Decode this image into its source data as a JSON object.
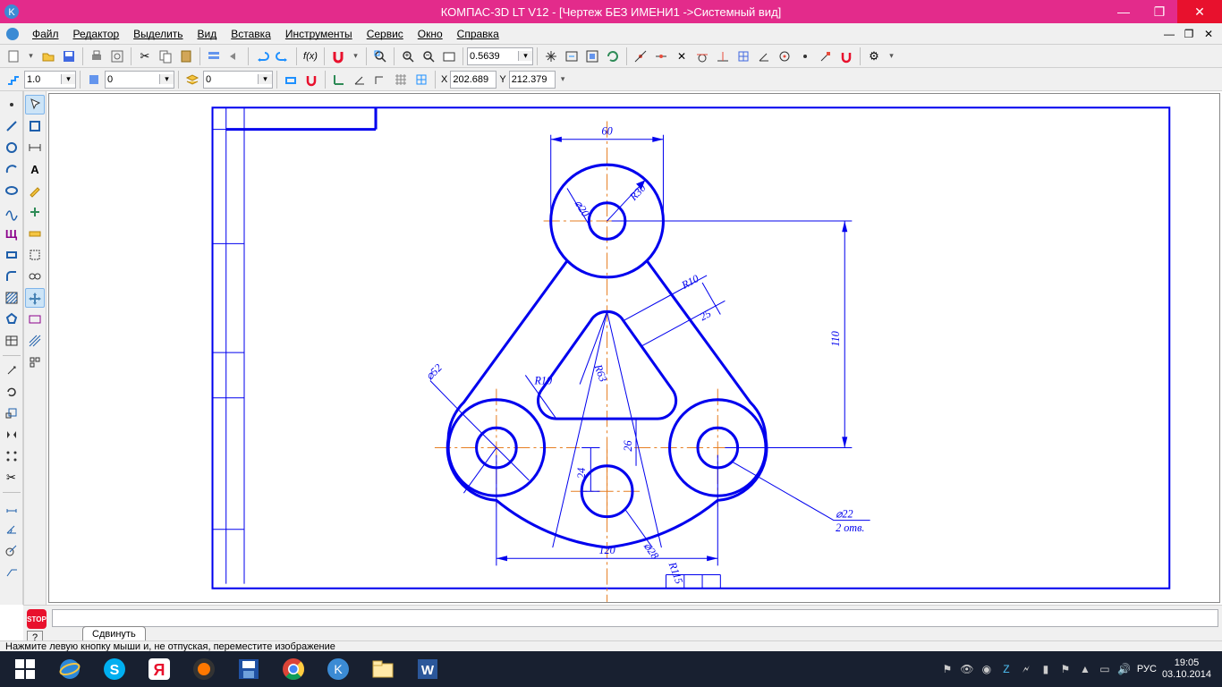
{
  "title": "КОМПАС-3D LT V12 - [Чертеж БЕЗ ИМЕНИ1 ->Системный вид]",
  "menu": {
    "file": "Файл",
    "edit": "Редактор",
    "select": "Выделить",
    "view": "Вид",
    "insert": "Вставка",
    "tools": "Инструменты",
    "service": "Сервис",
    "window": "Окно",
    "help": "Справка"
  },
  "zoom_value": "0.5639",
  "prop": {
    "step": "1.0",
    "style": "0",
    "layer": "0",
    "cx": "202.689",
    "cy": "212.379"
  },
  "cpanel_tab": "Сдвинуть",
  "status": "Нажмите левую кнопку мыши и, не отпуская, переместите изображение",
  "taskbar": {
    "lang": "РУС",
    "time": "19:05",
    "date": "03.10.2014"
  },
  "dims": {
    "d60": "60",
    "d20": "⌀20",
    "r30": "R30",
    "r10a": "R10",
    "d25": "25",
    "d110": "110",
    "r63": "R63",
    "r10b": "R10",
    "d52": "⌀52",
    "d24": "24",
    "d26": "26",
    "d28": "⌀28",
    "d120": "120",
    "r115": "R115",
    "d22": "⌀22",
    "d22s": "2 отв."
  }
}
